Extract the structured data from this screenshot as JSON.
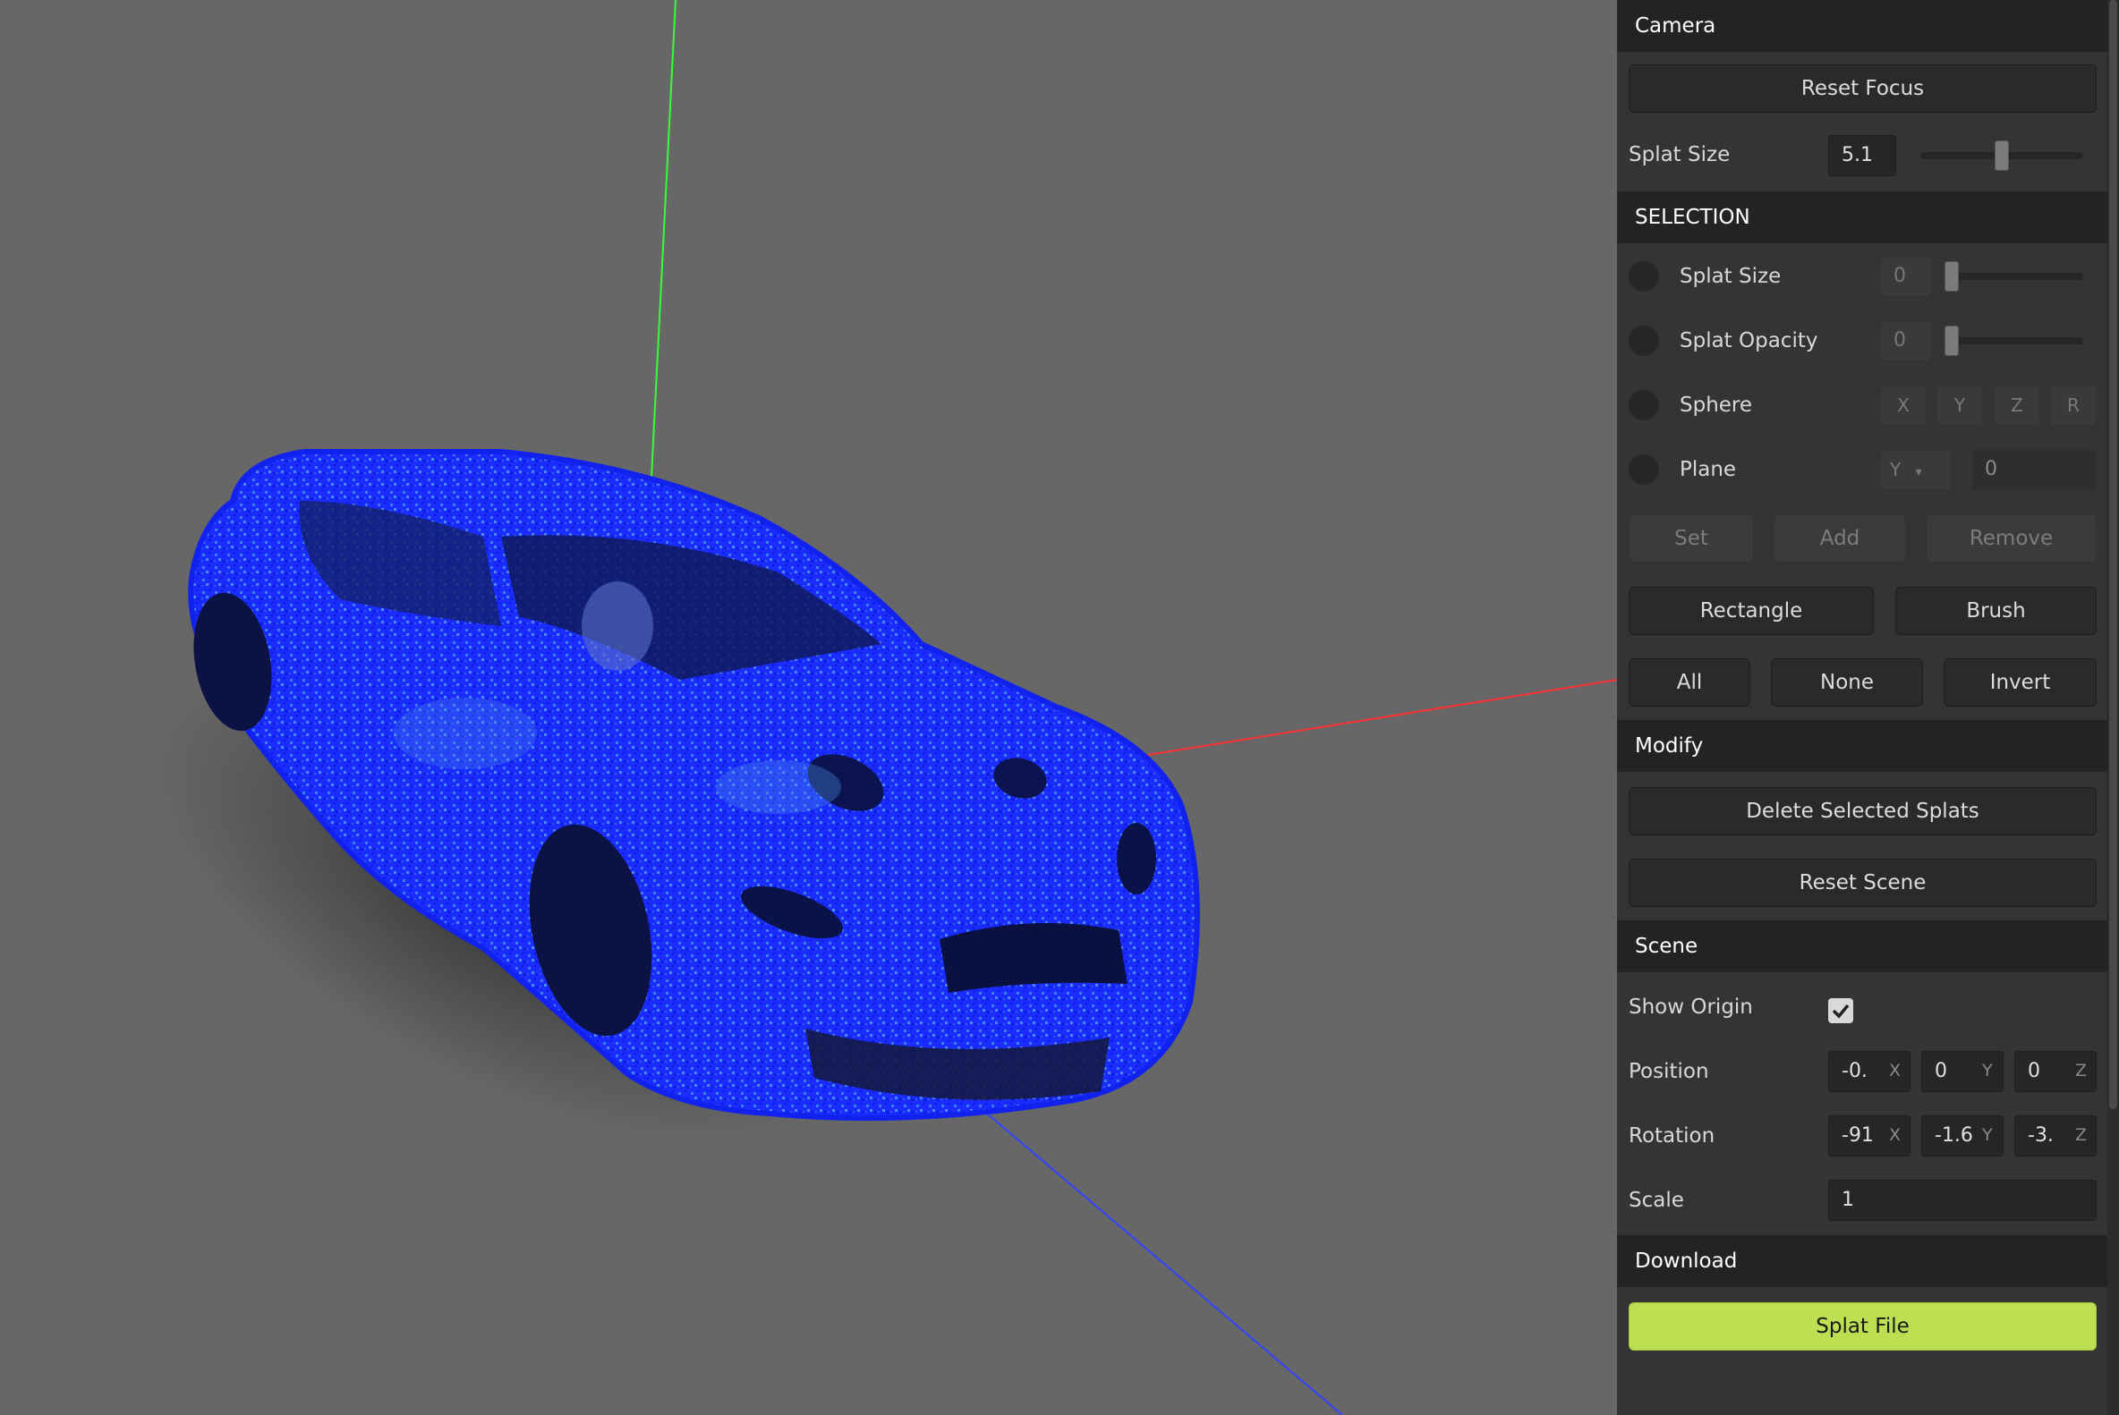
{
  "camera": {
    "title": "Camera",
    "reset_focus_label": "Reset Focus",
    "splat_size": {
      "label": "Splat Size",
      "value": "5.1",
      "slider_fraction": 0.5
    }
  },
  "selection": {
    "title": "SELECTION",
    "splat_size": {
      "label": "Splat Size",
      "value": "0",
      "slider_fraction": 0.0
    },
    "splat_opacity": {
      "label": "Splat Opacity",
      "value": "0",
      "slider_fraction": 0.0
    },
    "sphere": {
      "label": "Sphere",
      "x": "X",
      "y": "Y",
      "z": "Z",
      "r": "R"
    },
    "plane": {
      "label": "Plane",
      "axis": "Y",
      "value": "0"
    },
    "set_label": "Set",
    "add_label": "Add",
    "remove_label": "Remove",
    "rectangle_label": "Rectangle",
    "brush_label": "Brush",
    "all_label": "All",
    "none_label": "None",
    "invert_label": "Invert"
  },
  "modify": {
    "title": "Modify",
    "delete_label": "Delete Selected Splats",
    "reset_scene_label": "Reset Scene"
  },
  "scene": {
    "title": "Scene",
    "show_origin": {
      "label": "Show Origin",
      "checked": true
    },
    "position": {
      "label": "Position",
      "x": "-0.",
      "y": "0",
      "z": "0",
      "x_axis": "X",
      "y_axis": "Y",
      "z_axis": "Z"
    },
    "rotation": {
      "label": "Rotation",
      "x": "-91",
      "y": "-1.6",
      "z": "-3.",
      "x_axis": "X",
      "y_axis": "Y",
      "z_axis": "Z"
    },
    "scale": {
      "label": "Scale",
      "value": "1"
    }
  },
  "download": {
    "title": "Download",
    "splat_file_label": "Splat File"
  },
  "colors": {
    "viewport_bg": "#676767",
    "panel_bg": "#343434",
    "header_bg": "#232323",
    "accent": "#bddf52",
    "selected_splats": "#1a2cff",
    "axis_x": "#ff3030",
    "axis_y": "#30ff30",
    "axis_z": "#3040ff"
  }
}
